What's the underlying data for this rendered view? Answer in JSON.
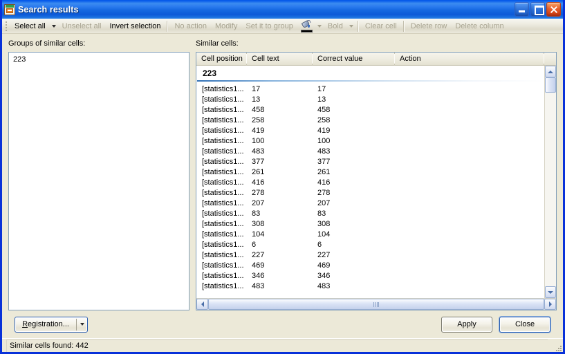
{
  "window": {
    "title": "Search results",
    "icon": "app-icon",
    "caption_buttons": [
      {
        "name": "minimize",
        "glyph": "minimize-icon"
      },
      {
        "name": "maximize",
        "glyph": "maximize-icon"
      },
      {
        "name": "close",
        "glyph": "close-icon"
      }
    ]
  },
  "toolbar": {
    "items": [
      {
        "label": "Select all",
        "disabled": false,
        "dropdown": true
      },
      {
        "label": "Unselect all",
        "disabled": true,
        "dropdown": false
      },
      {
        "label": "Invert selection",
        "disabled": false,
        "dropdown": false
      },
      {
        "label": "No action",
        "disabled": true,
        "dropdown": false
      },
      {
        "label": "Modify",
        "disabled": true,
        "dropdown": false
      },
      {
        "label": "Set it to group",
        "disabled": true,
        "dropdown": false
      },
      {
        "label": "Bold",
        "disabled": true,
        "dropdown": true
      },
      {
        "label": "Clear cell",
        "disabled": true,
        "dropdown": false
      },
      {
        "label": "Delete row",
        "disabled": true,
        "dropdown": false
      },
      {
        "label": "Delete column",
        "disabled": true,
        "dropdown": false
      }
    ],
    "fill_color_icon": "paint-bucket-icon",
    "fill_color": "#000000"
  },
  "left_pane": {
    "label": "Groups of similar cells:",
    "groups": [
      "223"
    ]
  },
  "right_pane": {
    "label": "Similar cells:",
    "columns": [
      "Cell position",
      "Cell text",
      "Correct value",
      "Action"
    ],
    "group_header": "223",
    "rows": [
      {
        "position": "[statistics1...",
        "text": "17",
        "correct": "17",
        "action": ""
      },
      {
        "position": "[statistics1...",
        "text": "13",
        "correct": "13",
        "action": ""
      },
      {
        "position": "[statistics1...",
        "text": "458",
        "correct": "458",
        "action": ""
      },
      {
        "position": "[statistics1...",
        "text": "258",
        "correct": "258",
        "action": ""
      },
      {
        "position": "[statistics1...",
        "text": "419",
        "correct": "419",
        "action": ""
      },
      {
        "position": "[statistics1...",
        "text": "100",
        "correct": "100",
        "action": ""
      },
      {
        "position": "[statistics1...",
        "text": "483",
        "correct": "483",
        "action": ""
      },
      {
        "position": "[statistics1...",
        "text": "377",
        "correct": "377",
        "action": ""
      },
      {
        "position": "[statistics1...",
        "text": "261",
        "correct": "261",
        "action": ""
      },
      {
        "position": "[statistics1...",
        "text": "416",
        "correct": "416",
        "action": ""
      },
      {
        "position": "[statistics1...",
        "text": "278",
        "correct": "278",
        "action": ""
      },
      {
        "position": "[statistics1...",
        "text": "207",
        "correct": "207",
        "action": ""
      },
      {
        "position": "[statistics1...",
        "text": "83",
        "correct": "83",
        "action": ""
      },
      {
        "position": "[statistics1...",
        "text": "308",
        "correct": "308",
        "action": ""
      },
      {
        "position": "[statistics1...",
        "text": "104",
        "correct": "104",
        "action": ""
      },
      {
        "position": "[statistics1...",
        "text": "6",
        "correct": "6",
        "action": ""
      },
      {
        "position": "[statistics1...",
        "text": "227",
        "correct": "227",
        "action": ""
      },
      {
        "position": "[statistics1...",
        "text": "469",
        "correct": "469",
        "action": ""
      },
      {
        "position": "[statistics1...",
        "text": "346",
        "correct": "346",
        "action": ""
      },
      {
        "position": "[statistics1...",
        "text": "483",
        "correct": "483",
        "action": ""
      }
    ]
  },
  "buttons": {
    "registration": "Registration...",
    "registration_accesskey": "R",
    "apply": "Apply",
    "close": "Close"
  },
  "statusbar": {
    "text": "Similar cells found: 442"
  }
}
